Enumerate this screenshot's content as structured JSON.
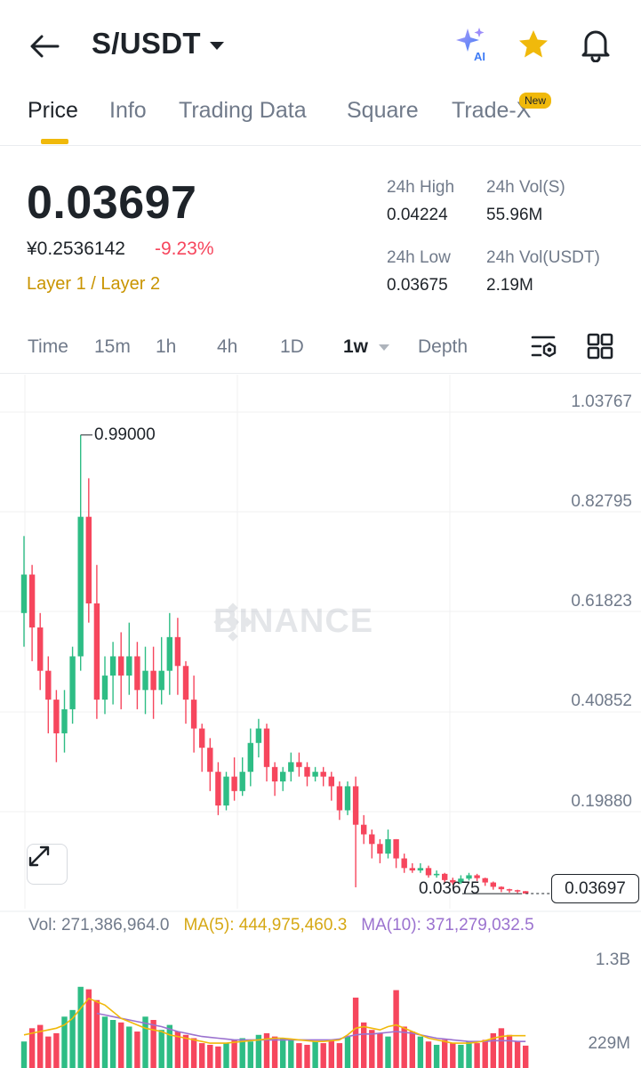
{
  "header": {
    "pair": "S/USDT",
    "ai_badge": "AI",
    "icons": [
      "back-arrow-icon",
      "ai-sparkle-icon",
      "favorite-star-icon",
      "notification-bell-icon"
    ]
  },
  "tabs": [
    {
      "label": "Price",
      "active": true
    },
    {
      "label": "Info"
    },
    {
      "label": "Trading Data"
    },
    {
      "label": "Square"
    },
    {
      "label": "Trade-X",
      "badge": "New"
    }
  ],
  "price": {
    "last": "0.03697",
    "cny": "¥0.2536142",
    "change": "-9.23%",
    "category": "Layer 1 / Layer 2"
  },
  "stats": {
    "high_label": "24h High",
    "high": "0.04224",
    "low_label": "24h Low",
    "low": "0.03675",
    "vol_s_label": "24h Vol(S)",
    "vol_s": "55.96M",
    "vol_usdt_label": "24h Vol(USDT)",
    "vol_usdt": "2.19M"
  },
  "intervals": [
    "Time",
    "15m",
    "1h",
    "4h",
    "1D",
    "1w",
    "Depth"
  ],
  "active_interval": "1w",
  "chart": {
    "watermark": "BINANCE",
    "y_ticks": [
      "1.03767",
      "0.82795",
      "0.61823",
      "0.40852",
      "0.19880"
    ],
    "max_marker": "0.99000",
    "min_marker": "0.03675",
    "last_price": "0.03697",
    "colors": {
      "up": "#2ebd85",
      "down": "#f6465d",
      "ma5": "#f0b90b",
      "ma10": "#9b72cf"
    }
  },
  "volume": {
    "vol": "Vol: 271,386,964.0",
    "ma5": "MA(5): 444,975,460.3",
    "ma10": "MA(10): 371,279,032.5",
    "axis_top": "1.3B",
    "axis_bottom": "229M"
  },
  "chart_data": {
    "type": "candlestick",
    "price_axis": [
      0.0,
      1.03767
    ],
    "candles": [
      [
        0.62,
        0.7,
        0.55,
        0.78
      ],
      [
        0.7,
        0.59,
        0.52,
        0.72
      ],
      [
        0.59,
        0.5,
        0.46,
        0.62
      ],
      [
        0.5,
        0.44,
        0.37,
        0.53
      ],
      [
        0.44,
        0.37,
        0.31,
        0.46
      ],
      [
        0.37,
        0.42,
        0.33,
        0.46
      ],
      [
        0.42,
        0.53,
        0.39,
        0.55
      ],
      [
        0.53,
        0.82,
        0.5,
        0.99
      ],
      [
        0.82,
        0.64,
        0.6,
        0.9
      ],
      [
        0.64,
        0.44,
        0.4,
        0.72
      ],
      [
        0.44,
        0.49,
        0.41,
        0.53
      ],
      [
        0.49,
        0.53,
        0.43,
        0.56
      ],
      [
        0.53,
        0.49,
        0.42,
        0.58
      ],
      [
        0.49,
        0.53,
        0.45,
        0.6
      ],
      [
        0.53,
        0.46,
        0.42,
        0.56
      ],
      [
        0.46,
        0.5,
        0.41,
        0.55
      ],
      [
        0.5,
        0.46,
        0.4,
        0.55
      ],
      [
        0.46,
        0.5,
        0.43,
        0.57
      ],
      [
        0.5,
        0.57,
        0.45,
        0.62
      ],
      [
        0.57,
        0.51,
        0.45,
        0.61
      ],
      [
        0.51,
        0.44,
        0.39,
        0.52
      ],
      [
        0.44,
        0.38,
        0.33,
        0.49
      ],
      [
        0.38,
        0.34,
        0.29,
        0.39
      ],
      [
        0.34,
        0.29,
        0.25,
        0.36
      ],
      [
        0.29,
        0.22,
        0.2,
        0.31
      ],
      [
        0.22,
        0.28,
        0.21,
        0.29
      ],
      [
        0.28,
        0.25,
        0.23,
        0.32
      ],
      [
        0.25,
        0.29,
        0.24,
        0.32
      ],
      [
        0.29,
        0.35,
        0.26,
        0.38
      ],
      [
        0.35,
        0.38,
        0.32,
        0.4
      ],
      [
        0.38,
        0.3,
        0.27,
        0.39
      ],
      [
        0.3,
        0.27,
        0.24,
        0.31
      ],
      [
        0.27,
        0.29,
        0.25,
        0.3
      ],
      [
        0.29,
        0.31,
        0.27,
        0.33
      ],
      [
        0.31,
        0.3,
        0.28,
        0.33
      ],
      [
        0.3,
        0.28,
        0.26,
        0.31
      ],
      [
        0.28,
        0.29,
        0.27,
        0.3
      ],
      [
        0.29,
        0.28,
        0.26,
        0.3
      ],
      [
        0.28,
        0.26,
        0.23,
        0.29
      ],
      [
        0.26,
        0.21,
        0.19,
        0.27
      ],
      [
        0.21,
        0.26,
        0.2,
        0.27
      ],
      [
        0.26,
        0.18,
        0.05,
        0.28
      ],
      [
        0.18,
        0.16,
        0.14,
        0.2
      ],
      [
        0.16,
        0.14,
        0.11,
        0.17
      ],
      [
        0.14,
        0.12,
        0.1,
        0.15
      ],
      [
        0.12,
        0.15,
        0.11,
        0.17
      ],
      [
        0.15,
        0.11,
        0.09,
        0.15
      ],
      [
        0.11,
        0.09,
        0.08,
        0.12
      ],
      [
        0.09,
        0.085,
        0.08,
        0.1
      ],
      [
        0.085,
        0.09,
        0.08,
        0.1
      ],
      [
        0.09,
        0.075,
        0.07,
        0.095
      ],
      [
        0.075,
        0.078,
        0.07,
        0.085
      ],
      [
        0.078,
        0.065,
        0.06,
        0.08
      ],
      [
        0.065,
        0.06,
        0.055,
        0.07
      ],
      [
        0.06,
        0.068,
        0.057,
        0.075
      ],
      [
        0.068,
        0.075,
        0.064,
        0.08
      ],
      [
        0.075,
        0.069,
        0.063,
        0.078
      ],
      [
        0.069,
        0.06,
        0.053,
        0.07
      ],
      [
        0.06,
        0.051,
        0.045,
        0.062
      ],
      [
        0.051,
        0.046,
        0.04,
        0.052
      ],
      [
        0.046,
        0.044,
        0.039,
        0.047
      ],
      [
        0.044,
        0.042,
        0.038,
        0.045
      ],
      [
        0.042,
        0.03697,
        0.03675,
        0.04224
      ]
    ],
    "volume_axis": [
      0,
      1.3
    ],
    "volume": [
      0.32,
      0.48,
      0.52,
      0.38,
      0.42,
      0.62,
      0.7,
      0.98,
      0.95,
      0.82,
      0.62,
      0.58,
      0.55,
      0.5,
      0.44,
      0.62,
      0.58,
      0.46,
      0.52,
      0.44,
      0.4,
      0.36,
      0.3,
      0.28,
      0.26,
      0.3,
      0.34,
      0.36,
      0.32,
      0.4,
      0.42,
      0.38,
      0.36,
      0.34,
      0.3,
      0.28,
      0.32,
      0.3,
      0.34,
      0.3,
      0.38,
      0.85,
      0.55,
      0.46,
      0.42,
      0.38,
      0.94,
      0.5,
      0.44,
      0.38,
      0.32,
      0.28,
      0.34,
      0.3,
      0.28,
      0.32,
      0.3,
      0.34,
      0.42,
      0.48,
      0.4,
      0.32,
      0.27
    ],
    "ma5": [
      0.4,
      0.42,
      0.44,
      0.46,
      0.48,
      0.52,
      0.6,
      0.72,
      0.84,
      0.8,
      0.76,
      0.68,
      0.6,
      0.56,
      0.52,
      0.48,
      0.46,
      0.44,
      0.4,
      0.38,
      0.36,
      0.34,
      0.32,
      0.3,
      0.3,
      0.3,
      0.31,
      0.32,
      0.33,
      0.34,
      0.35,
      0.36,
      0.36,
      0.35,
      0.34,
      0.33,
      0.32,
      0.32,
      0.33,
      0.34,
      0.4,
      0.48,
      0.5,
      0.48,
      0.46,
      0.5,
      0.52,
      0.48,
      0.44,
      0.4,
      0.36,
      0.34,
      0.32,
      0.3,
      0.3,
      0.3,
      0.31,
      0.33,
      0.36,
      0.38,
      0.39,
      0.39,
      0.39
    ],
    "ma10": [
      null,
      null,
      null,
      null,
      null,
      null,
      null,
      null,
      null,
      0.66,
      0.64,
      0.62,
      0.6,
      0.58,
      0.56,
      0.54,
      0.52,
      0.5,
      0.47,
      0.44,
      0.42,
      0.4,
      0.38,
      0.37,
      0.36,
      0.35,
      0.34,
      0.34,
      0.34,
      0.34,
      0.34,
      0.34,
      0.34,
      0.34,
      0.34,
      0.34,
      0.34,
      0.34,
      0.34,
      0.35,
      0.38,
      0.4,
      0.41,
      0.41,
      0.42,
      0.43,
      0.44,
      0.43,
      0.42,
      0.4,
      0.38,
      0.36,
      0.35,
      0.34,
      0.33,
      0.32,
      0.32,
      0.32,
      0.33,
      0.33,
      0.33,
      0.32,
      0.32
    ]
  }
}
